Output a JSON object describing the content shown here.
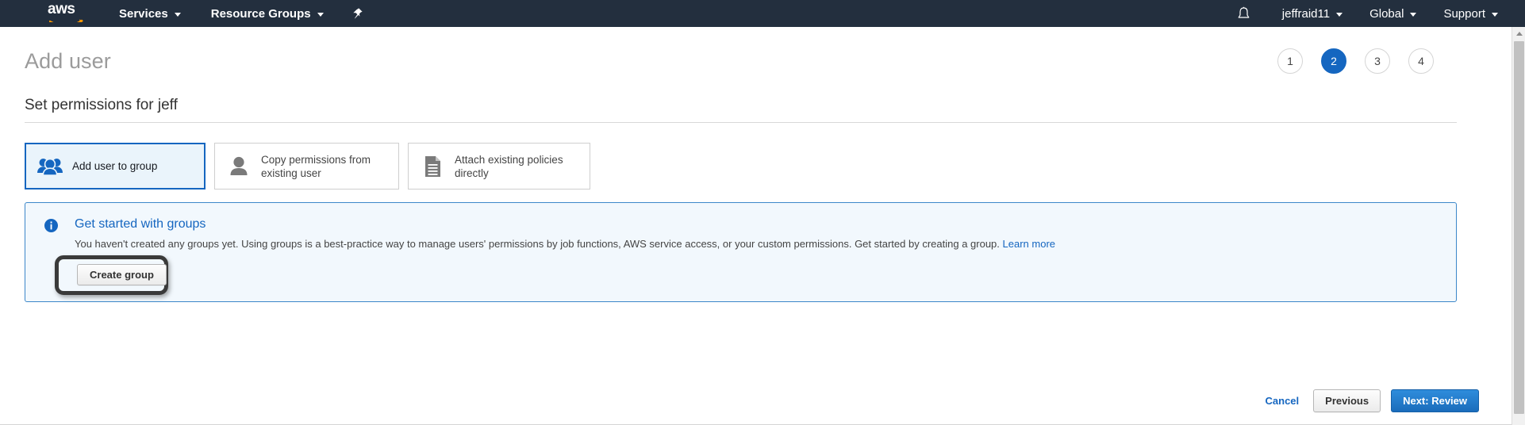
{
  "navbar": {
    "logo_alt": "aws",
    "items": [
      {
        "label": "Services",
        "has_caret": true
      },
      {
        "label": "Resource Groups",
        "has_caret": true
      }
    ],
    "pin_icon": "pin-icon",
    "bell_icon": "bell-icon",
    "right_items": [
      {
        "label": "jeffraid11",
        "has_caret": true
      },
      {
        "label": "Global",
        "has_caret": true
      },
      {
        "label": "Support",
        "has_caret": true
      }
    ]
  },
  "header": {
    "title": "Add user",
    "steps": [
      {
        "number": "1",
        "active": false
      },
      {
        "number": "2",
        "active": true
      },
      {
        "number": "3",
        "active": false
      },
      {
        "number": "4",
        "active": false
      }
    ]
  },
  "section": {
    "heading": "Set permissions for jeff"
  },
  "option_cards": [
    {
      "label": "Add user to group",
      "icon": "group-of-users-icon",
      "selected": true
    },
    {
      "label": "Copy permissions from existing user",
      "icon": "single-user-icon",
      "selected": false
    },
    {
      "label": "Attach existing policies directly",
      "icon": "document-policy-icon",
      "selected": false
    }
  ],
  "alert": {
    "icon": "info-circle-icon",
    "title": "Get started with groups",
    "body": "You haven't created any groups yet. Using groups is a best-practice way to manage users' permissions by job functions, AWS service access, or your custom permissions. Get started by creating a group.",
    "link_label": "Learn more",
    "create_group_button": "Create group"
  },
  "footer": {
    "cancel_label": "Cancel",
    "previous_label": "Previous",
    "next_label": "Next: Review"
  },
  "colors": {
    "nav_background": "#232f3e",
    "aws_orange": "#ff9900",
    "accent_blue": "#1566c0",
    "alert_background": "#f2f8fd",
    "alert_border": "#3c87c9",
    "selected_card_background": "#eaf4fb",
    "title_gray": "#9b9b9b",
    "icon_gray": "#7a7a7a",
    "annotation_outline": "#3a3a3a"
  },
  "scrollbar": {
    "up_arrow_icon": "scroll-up-arrow-icon"
  }
}
